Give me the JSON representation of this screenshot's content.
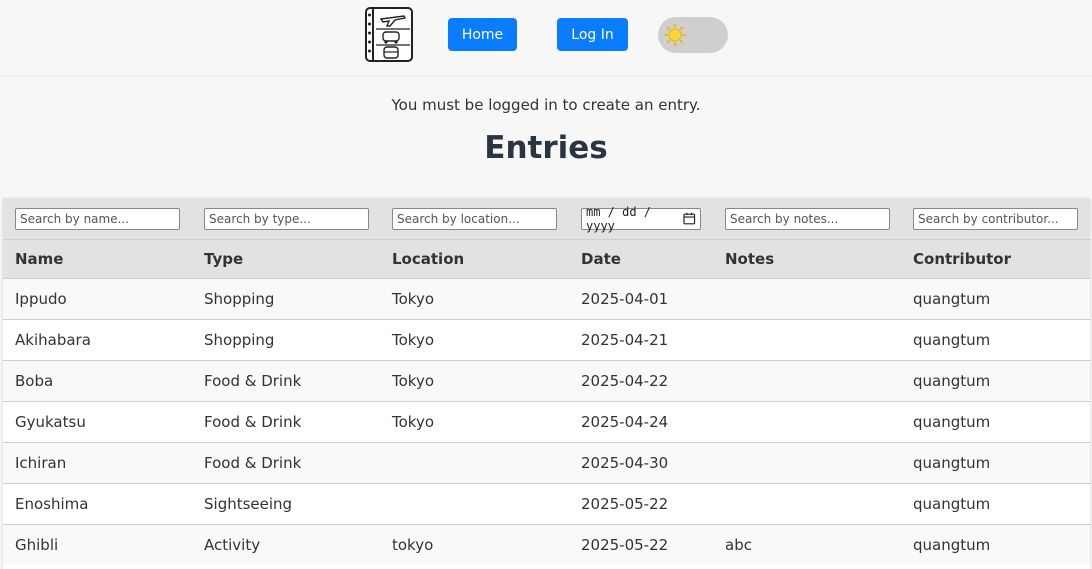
{
  "nav": {
    "home_label": "Home",
    "login_label": "Log In",
    "theme_icon": "sun-icon",
    "accent": "#0a7cff"
  },
  "notice": "You must be logged in to create an entry.",
  "title": "Entries",
  "filters": {
    "name_placeholder": "Search by name...",
    "type_placeholder": "Search by type...",
    "location_placeholder": "Search by location...",
    "date_placeholder": "mm / dd / yyyy",
    "notes_placeholder": "Search by notes...",
    "contributor_placeholder": "Search by contributor..."
  },
  "columns": [
    "Name",
    "Type",
    "Location",
    "Date",
    "Notes",
    "Contributor"
  ],
  "rows": [
    [
      "Ippudo",
      "Shopping",
      "Tokyo",
      "2025-04-01",
      "",
      "quangtum"
    ],
    [
      "Akihabara",
      "Shopping",
      "Tokyo",
      "2025-04-21",
      "",
      "quangtum"
    ],
    [
      "Boba",
      "Food & Drink",
      "Tokyo",
      "2025-04-22",
      "",
      "quangtum"
    ],
    [
      "Gyukatsu",
      "Food & Drink",
      "Tokyo",
      "2025-04-24",
      "",
      "quangtum"
    ],
    [
      "Ichiran",
      "Food & Drink",
      "",
      "2025-04-30",
      "",
      "quangtum"
    ],
    [
      "Enoshima",
      "Sightseeing",
      "",
      "2025-05-22",
      "",
      "quangtum"
    ],
    [
      "Ghibli",
      "Activity",
      "tokyo",
      "2025-05-22",
      "abc",
      "quangtum"
    ]
  ]
}
